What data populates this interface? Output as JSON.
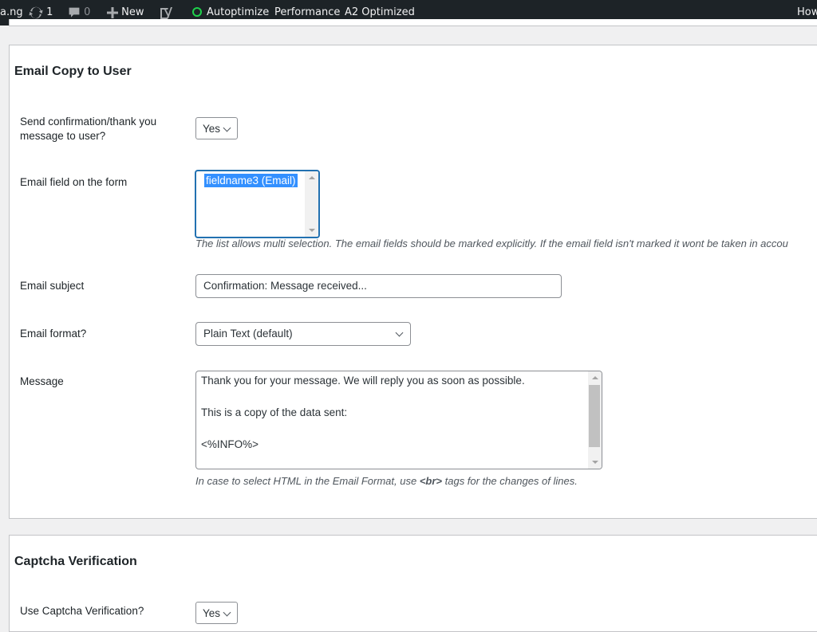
{
  "adminbar": {
    "site_name_fragment": "a.ng",
    "updates_count": "1",
    "comments_count": "0",
    "new_label": "New",
    "autoptimize_label": "Autoptimize",
    "performance_label": "Performance",
    "a2_label": "A2 Optimized",
    "howdy_fragment": "How",
    "status_color": "#1ed14b"
  },
  "email_copy": {
    "title": "Email Copy to User",
    "send_confirmation": {
      "label": "Send confirmation/thank you message to user?",
      "value": "Yes"
    },
    "email_field": {
      "label": "Email field on the form",
      "selected_option": "fieldname3 (Email)",
      "hint": "The list allows multi selection. The email fields should be marked explicitly. If the email field isn't marked it wont be taken in accou"
    },
    "email_subject": {
      "label": "Email subject",
      "value": "Confirmation: Message received..."
    },
    "email_format": {
      "label": "Email format?",
      "value": "Plain Text (default)"
    },
    "message": {
      "label": "Message",
      "lines": [
        "Thank you for your message. We will reply you as soon as possible.",
        "This is a copy of the data sent:",
        "<%INFO%>"
      ],
      "hint_before": "In case to select HTML in the Email Format, use ",
      "hint_code": "<br>",
      "hint_after": " tags for the changes of lines."
    }
  },
  "captcha": {
    "title": "Captcha Verification",
    "use_captcha": {
      "label": "Use Captcha Verification?",
      "value": "Yes"
    }
  }
}
